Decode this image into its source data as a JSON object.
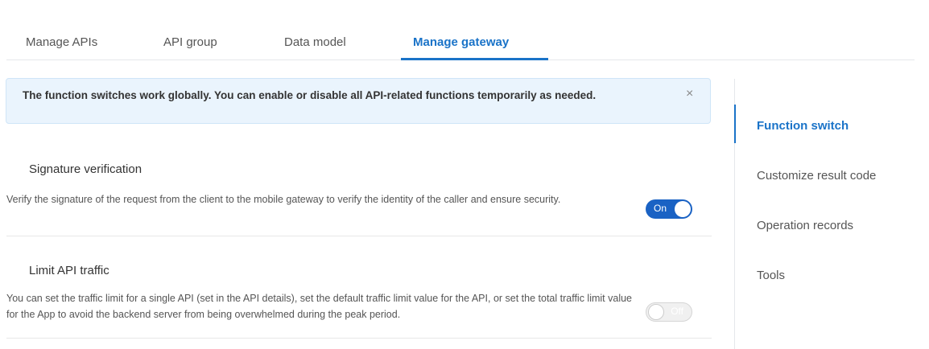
{
  "tabs": [
    {
      "label": "Manage APIs"
    },
    {
      "label": "API group"
    },
    {
      "label": "Data model"
    },
    {
      "label": "Manage gateway"
    }
  ],
  "alert": {
    "text": "The function switches work globally. You can enable or disable all API-related functions temporarily as needed.",
    "close_icon": "×"
  },
  "sections": [
    {
      "title": "Signature verification",
      "description": "Verify the signature of the request from the client to the mobile gateway to verify the identity of the caller and ensure security.",
      "toggle_label": "On",
      "toggle_state": "on"
    },
    {
      "title": "Limit API traffic",
      "description": "You can set the traffic limit for a single API (set in the API details), set the default traffic limit value for the API, or set the total traffic limit value for the App to avoid the backend server from being overwhelmed during the peak period.",
      "toggle_label": "Off",
      "toggle_state": "off"
    }
  ],
  "right_nav": {
    "items": [
      {
        "label": "Function switch"
      },
      {
        "label": "Customize result code"
      },
      {
        "label": "Operation records"
      },
      {
        "label": "Tools"
      }
    ]
  },
  "colors": {
    "accent": "#1a73c8",
    "toggle_on": "#1a62c4",
    "alert_bg": "#eaf4fd"
  }
}
